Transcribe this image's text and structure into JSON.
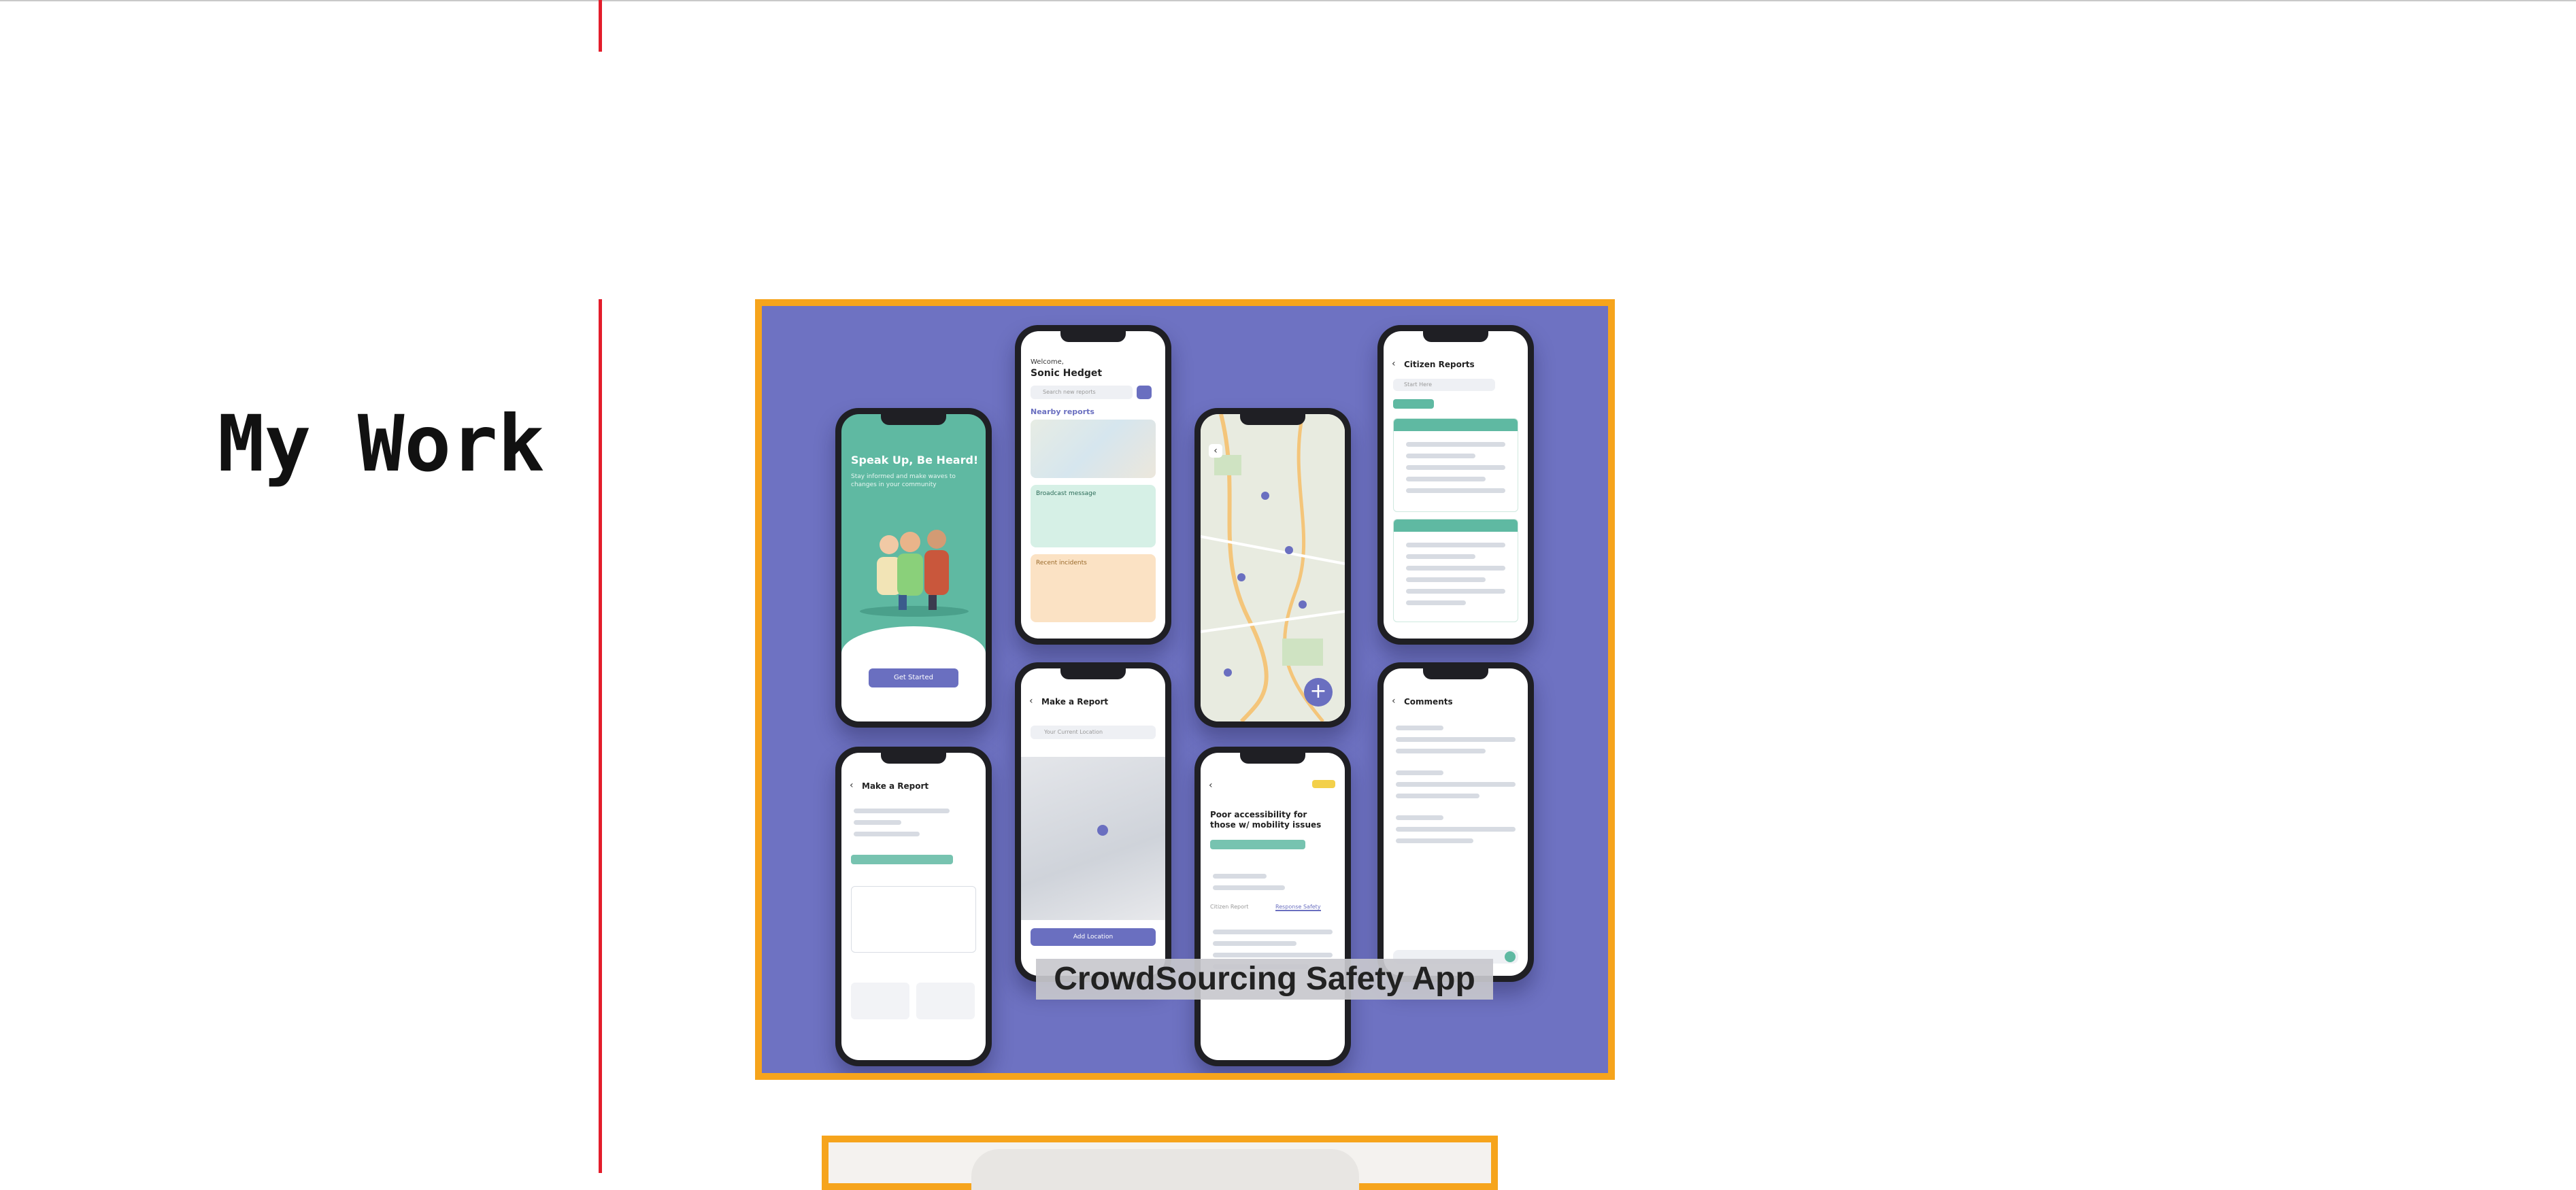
{
  "section": {
    "title": "My Work"
  },
  "projects": [
    {
      "caption": "CrowdSourcing Safety App",
      "screens": {
        "onboarding": {
          "headline": "Speak Up, Be Heard!",
          "subtext": "Stay informed and make waves to changes in your community",
          "cta": "Get Started"
        },
        "home": {
          "greeting": "Welcome,",
          "user": "Sonic Hedget",
          "search_placeholder": "Search new reports",
          "section": "Nearby reports",
          "card1": "Broadcast message",
          "card2": "Recent incidents"
        },
        "citizen_reports": {
          "title": "Citizen Reports",
          "search_placeholder": "Start Here"
        },
        "make_report": {
          "title": "Make a Report",
          "location_placeholder": "Your Current Location",
          "action": "Add Location"
        },
        "report_detail": {
          "title": "Poor accessibility for those w/ mobility issues",
          "tab1": "Citizen Report",
          "tab2": "Response Safety"
        },
        "comments": {
          "title": "Comments"
        }
      }
    },
    {
      "caption": ""
    }
  ],
  "colors": {
    "accent_line": "#e31d2b",
    "card_border": "#f6a41c",
    "card_background": "#6e72c2",
    "teal": "#5fb9a2"
  },
  "icons": {
    "back": "chevron-left-icon",
    "add": "plus-icon",
    "location": "map-pin-icon"
  }
}
